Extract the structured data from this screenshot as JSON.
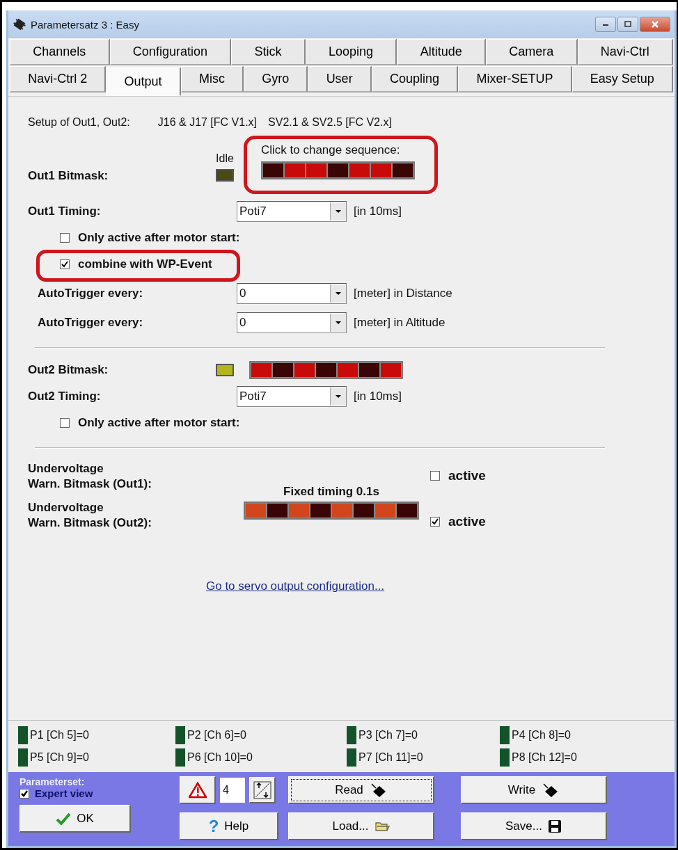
{
  "window": {
    "title": "Parametersatz 3 : Easy"
  },
  "tab_rows": [
    [
      {
        "label": "Channels",
        "selected": false
      },
      {
        "label": "Configuration",
        "selected": false
      },
      {
        "label": "Stick",
        "selected": false
      },
      {
        "label": "Looping",
        "selected": false
      },
      {
        "label": "Altitude",
        "selected": false
      },
      {
        "label": "Camera",
        "selected": false
      },
      {
        "label": "Navi-Ctrl",
        "selected": false
      }
    ],
    [
      {
        "label": "Navi-Ctrl 2",
        "selected": false
      },
      {
        "label": "Output",
        "selected": true
      },
      {
        "label": "Misc",
        "selected": false
      },
      {
        "label": "Gyro",
        "selected": false
      },
      {
        "label": "User",
        "selected": false
      },
      {
        "label": "Coupling",
        "selected": false
      },
      {
        "label": "Mixer-SETUP",
        "selected": false
      },
      {
        "label": "Easy Setup",
        "selected": false
      }
    ]
  ],
  "setup": {
    "label": "Setup of Out1, Out2:",
    "fc_v1": "J16 & J17 [FC V1.x]",
    "fc_v2": "SV2.1 & SV2.5 [FC V2.x]"
  },
  "out1": {
    "label": "Out1 Bitmask:",
    "idle_label": "Idle",
    "sequence_label": "Click to change sequence:",
    "highlighted": true,
    "cells": [
      {
        "color": "#3a0505"
      },
      {
        "color": "#c80a0a"
      },
      {
        "color": "#c80a0a"
      },
      {
        "color": "#3a0505"
      },
      {
        "color": "#c80a0a"
      },
      {
        "color": "#c80a0a"
      },
      {
        "color": "#3a0505"
      }
    ]
  },
  "out1_timing": {
    "label": "Out1 Timing:",
    "value": "Poti7",
    "unit": "[in 10ms]"
  },
  "out1_options": [
    {
      "label": "Only active after motor start:",
      "checked": false,
      "highlighted": false
    },
    {
      "label": "combine with WP-Event",
      "checked": true,
      "highlighted": true
    }
  ],
  "autotrigger": [
    {
      "label": "AutoTrigger every:",
      "value": "0",
      "unit": "[meter] in Distance"
    },
    {
      "label": "AutoTrigger every:",
      "value": "0",
      "unit": "[meter] in Altitude"
    }
  ],
  "out2": {
    "label": "Out2 Bitmask:",
    "cells": [
      {
        "color": "#c80a0a"
      },
      {
        "color": "#3a0505"
      },
      {
        "color": "#c80a0a"
      },
      {
        "color": "#3a0505"
      },
      {
        "color": "#c80a0a"
      },
      {
        "color": "#3a0505"
      },
      {
        "color": "#c80a0a"
      }
    ]
  },
  "out2_timing": {
    "label": "Out2 Timing:",
    "value": "Poti7",
    "unit": "[in 10ms]"
  },
  "out2_options": [
    {
      "label": "Only active after motor start:",
      "checked": false
    }
  ],
  "undervoltage": {
    "fixed_timing": "Fixed timing 0.1s",
    "rows": [
      {
        "label_lines": [
          "Undervoltage",
          "Warn. Bitmask (Out1):"
        ],
        "active_label": "active",
        "checked": false
      },
      {
        "label_lines": [
          "Undervoltage",
          "Warn. Bitmask (Out2):"
        ],
        "active_label": "active",
        "checked": true
      }
    ],
    "cells": [
      {
        "color": "#d2461e"
      },
      {
        "color": "#3a0505"
      },
      {
        "color": "#d2461e"
      },
      {
        "color": "#3a0505"
      },
      {
        "color": "#d2461e"
      },
      {
        "color": "#3a0505"
      },
      {
        "color": "#d2461e"
      },
      {
        "color": "#3a0505"
      }
    ]
  },
  "servo_link": "Go to servo output configuration...",
  "pots": [
    "P1 [Ch 5]=0",
    "P2 [Ch 6]=0",
    "P3 [Ch 7]=0",
    "P4 [Ch 8]=0",
    "P5 [Ch 9]=0",
    "P6 [Ch 10]=0",
    "P7 [Ch 11]=0",
    "P8 [Ch 12]=0"
  ],
  "bottom": {
    "parameterset_label": "Parameterset:",
    "expert_view": {
      "label": "Expert view",
      "checked": true
    },
    "set_number": "4",
    "read": "Read",
    "write": "Write",
    "ok": "OK",
    "help_glyph": "?",
    "help": "Help",
    "load": "Load...",
    "save": "Save..."
  }
}
